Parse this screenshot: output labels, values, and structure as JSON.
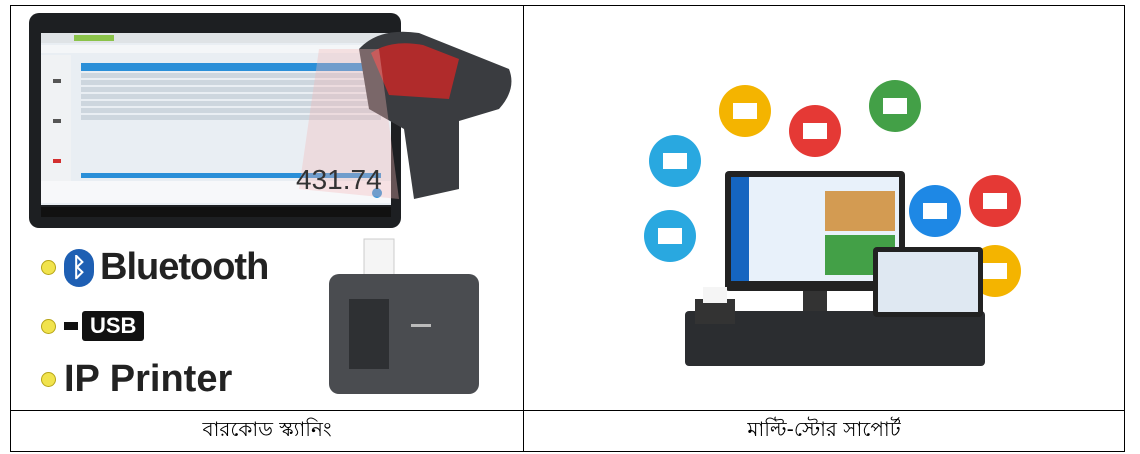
{
  "captions": {
    "left": "বারকোড স্ক্যানিং",
    "right": "মাল্টি-স্টোর সাপোর্ট"
  },
  "left_image": {
    "bluetooth_label": "Bluetooth",
    "usb_label": "USB",
    "ip_printer_label": "IP Printer",
    "tablet_total": "431.74"
  },
  "colors": {
    "bluetooth_blue": "#1e5fb3",
    "bullet_yellow": "#f1e34d",
    "tablet_header_blue": "#2a8fd8"
  }
}
